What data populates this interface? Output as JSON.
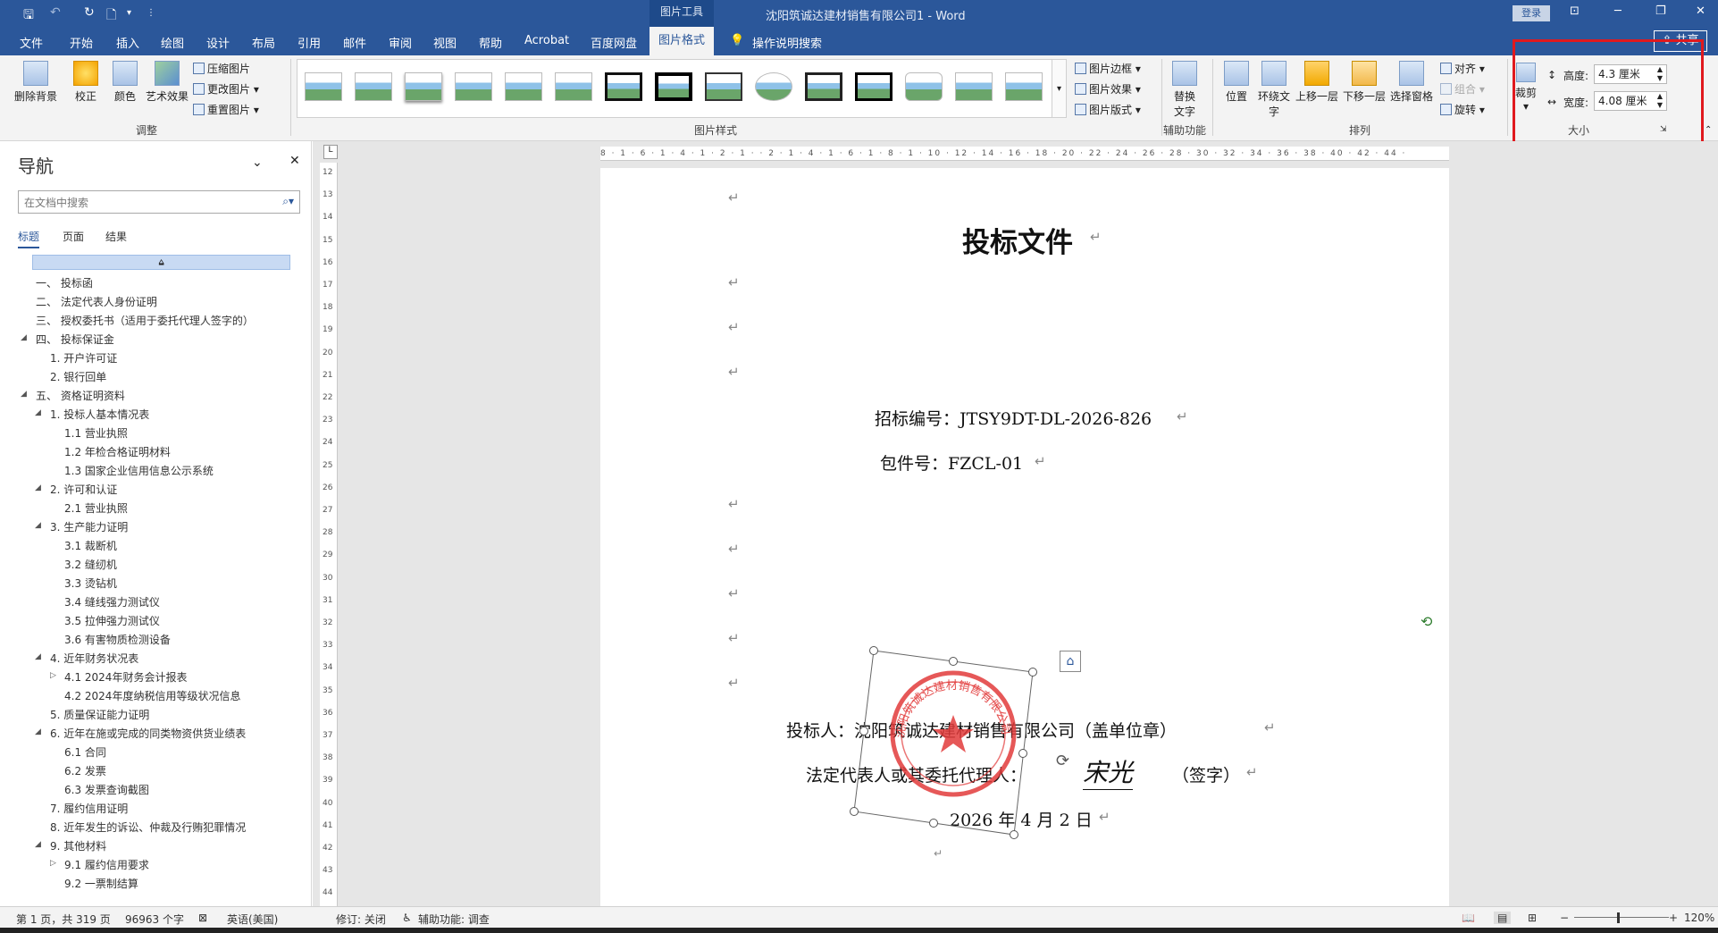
{
  "titlebar": {
    "context_group": "图片工具",
    "document_title": "沈阳筑诚达建材销售有限公司1 - Word",
    "login": "登录"
  },
  "tabs": [
    "文件",
    "开始",
    "插入",
    "绘图",
    "设计",
    "布局",
    "引用",
    "邮件",
    "审阅",
    "视图",
    "帮助",
    "Acrobat",
    "百度网盘"
  ],
  "active_tab": "图片格式",
  "tell_me": "操作说明搜索",
  "share": "共享",
  "ribbon": {
    "remove_bg": "删除背景",
    "corrections": "校正",
    "color": "颜色",
    "artistic": "艺术效果",
    "compress": "压缩图片",
    "change_picture": "更改图片",
    "reset_picture": "重置图片",
    "group_adjust": "调整",
    "pic_border": "图片边框",
    "pic_effects": "图片效果",
    "pic_layout": "图片版式",
    "group_styles": "图片样式",
    "alt_text_l1": "替换",
    "alt_text_l2": "文字",
    "group_access": "辅助功能",
    "position": "位置",
    "wrap_l1": "环绕文",
    "wrap_l2": "字",
    "bring_forward": "上移一层",
    "send_backward": "下移一层",
    "selection_pane": "选择窗格",
    "align": "对齐",
    "group_obj": "组合",
    "rotate": "旋转",
    "group_arrange": "排列",
    "crop": "裁剪",
    "height_label": "高度:",
    "height_value": "4.3 厘米",
    "width_label": "宽度:",
    "width_value": "4.08 厘米",
    "group_size": "大小"
  },
  "nav": {
    "title": "导航",
    "search_placeholder": "在文档中搜索",
    "tabs": [
      "标题",
      "页面",
      "结果"
    ],
    "items": [
      "一、 投标函",
      "二、 法定代表人身份证明",
      "三、 授权委托书（适用于委托代理人签字的）",
      "四、 投标保证金",
      "1. 开户许可证",
      "2. 银行回单",
      "五、 资格证明资料",
      "1. 投标人基本情况表",
      "1.1 营业执照",
      "1.2 年检合格证明材料",
      "1.3 国家企业信用信息公示系统",
      "2. 许可和认证",
      "2.1 营业执照",
      "3. 生产能力证明",
      "3.1 裁断机",
      "3.2 缝纫机",
      "3.3 烫钻机",
      "3.4 缝线强力测试仪",
      "3.5 拉伸强力测试仪",
      "3.6 有害物质检测设备",
      "4. 近年财务状况表",
      "4.1 2024年财务会计报表",
      "4.2 2024年度纳税信用等级状况信息",
      "5. 质量保证能力证明",
      "6. 近年在施或完成的同类物资供货业绩表",
      "6.1 合同",
      "6.2 发票",
      "6.3 发票查询截图",
      "7. 履约信用证明",
      "8. 近年发生的诉讼、仲裁及行贿犯罪情况",
      "9. 其他材料",
      "9.1 履约信用要求",
      "9.2 一票制结算"
    ]
  },
  "ruler": {
    "h_ticks": "8 · 1 · 6 · 1 · 4 · 1 · 2 · 1 · · 2 · 1 · 4 · 1 · 6 · 1 · 8 · 1 · 10 · 12 · 14 · 16 · 18 · 20 · 22 · 24 · 26 · 28 · 30 · 32 · 34 · 36 · 38 · 40 · 42 · 44 ·",
    "v_ticks": [
      "12",
      "13",
      "14",
      "15",
      "16",
      "17",
      "18",
      "19",
      "20",
      "21",
      "22",
      "23",
      "24",
      "25",
      "26",
      "27",
      "28",
      "29",
      "30",
      "31",
      "32",
      "33",
      "34",
      "35",
      "36",
      "37",
      "38",
      "39",
      "40",
      "41",
      "42",
      "43",
      "44"
    ]
  },
  "doc": {
    "title": "投标文件",
    "bid_no": "招标编号：JTSY9DT-DL-2026-826",
    "pkg_no": "包件号：FZCL-01",
    "bidder": "投标人：沈阳筑诚达建材销售有限公司（盖单位章）",
    "rep": "法定代表人或其委托代理人：",
    "signature": "宋光",
    "sign_note": "（签字）",
    "date": "2026 年 4 月 2 日",
    "stamp_text": "沈阳筑诚达建材销售有限公司"
  },
  "status": {
    "page": "第 1 页，共 319 页",
    "words": "96963 个字",
    "lang": "英语(美国)",
    "track": "修订: 关闭",
    "access": "辅助功能: 调查",
    "zoom": "120%"
  }
}
